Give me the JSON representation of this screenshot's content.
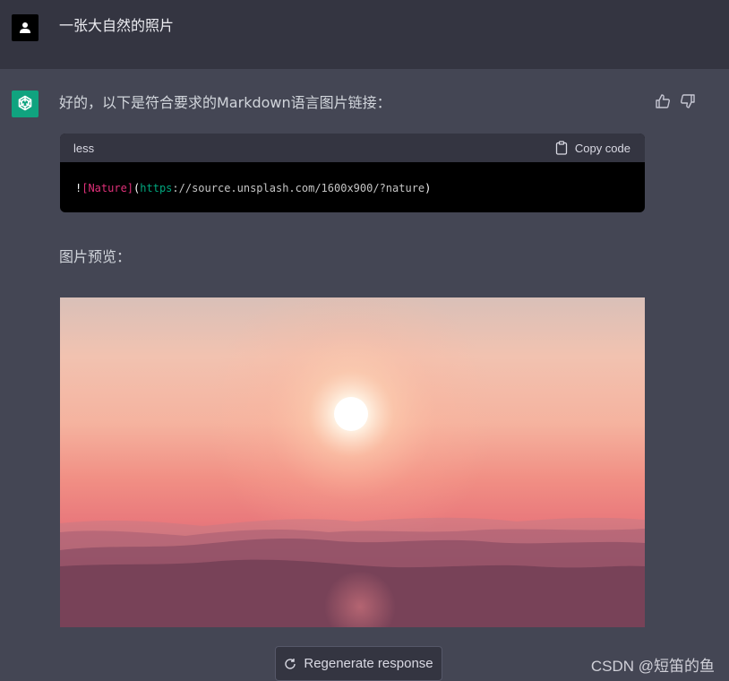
{
  "conversation": {
    "user_message": "一张大自然的照片",
    "assistant": {
      "intro": "好的，以下是符合要求的Markdown语言图片链接：",
      "code_block": {
        "language": "less",
        "copy_label": "Copy code",
        "tokens": {
          "bang": "!",
          "alt": "[Nature]",
          "open_paren": "(",
          "protocol": "https",
          "rest": "://source.unsplash.com/1600x900/?nature",
          "close_paren": ")"
        }
      },
      "preview_label": "图片预览：",
      "image_subject": "sunset over misty mountains"
    }
  },
  "icons": {
    "user_avatar": "user-icon",
    "assistant_avatar": "openai-logo-icon",
    "thumbs_up": "thumbs-up-icon",
    "thumbs_down": "thumbs-down-icon",
    "copy": "clipboard-icon",
    "regenerate": "refresh-icon"
  },
  "footer": {
    "regenerate_label": "Regenerate response"
  },
  "watermark": "CSDN @短笛的鱼",
  "colors": {
    "user_row_bg": "#343541",
    "assistant_row_bg": "#444654",
    "assistant_avatar_bg": "#10a37f",
    "code_bg": "#000000",
    "code_header_bg": "#343541"
  }
}
